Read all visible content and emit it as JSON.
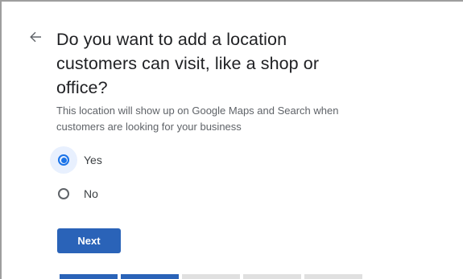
{
  "header": {
    "back_icon": "arrow-left-icon",
    "title": "Do you want to add a location customers can visit, like a shop or office?"
  },
  "description": "This location will show up on Google Maps and Search when customers are looking for your business",
  "options": [
    {
      "label": "Yes",
      "selected": true
    },
    {
      "label": "No",
      "selected": false
    }
  ],
  "actions": {
    "next_label": "Next"
  },
  "progress": {
    "steps_total": 5,
    "steps_completed": 2
  },
  "colors": {
    "accent": "#1a73e8",
    "button": "#2a63b8",
    "title_text": "#202124",
    "body_text": "#5f6368"
  }
}
